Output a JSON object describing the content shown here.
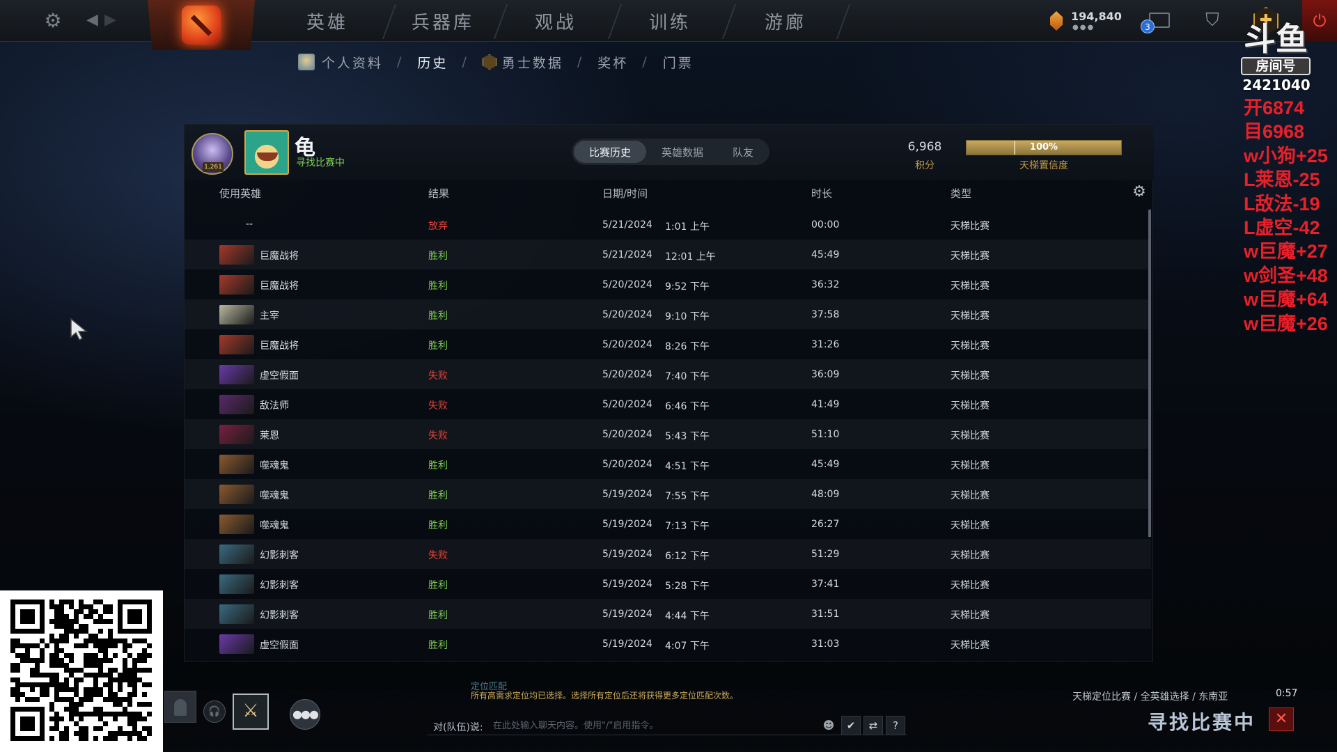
{
  "app": {
    "name": "Dota 2"
  },
  "topbar": {
    "gear_icon": "gear-icon",
    "back_icon": "arrow-left-icon",
    "forward_icon": "arrow-right-icon",
    "tabs": [
      {
        "label": "英雄"
      },
      {
        "label": "兵器库"
      },
      {
        "label": "观战"
      },
      {
        "label": "训练"
      },
      {
        "label": "游廊"
      }
    ],
    "gold": "194,840",
    "mail_badge": "3"
  },
  "subnav": {
    "items": [
      {
        "label": "个人资料"
      },
      {
        "label": "历史"
      },
      {
        "label": "勇士数据"
      },
      {
        "label": "奖杯"
      },
      {
        "label": "门票"
      }
    ],
    "active": "历史"
  },
  "overlay": {
    "logo_text": "斗鱼",
    "room_label": "房间号",
    "room_number": "2421040",
    "lines": [
      "开6874",
      "目6968",
      "w小狗+25",
      "L莱恩-25",
      "L敌法-19",
      "L虚空-42",
      "w巨魔+27",
      "w剑圣+48",
      "w巨魔+64",
      "w巨魔+26"
    ]
  },
  "profile": {
    "name": "龟",
    "status": "寻找比赛中",
    "rank_badge": "1,261",
    "tabs": [
      {
        "label": "比赛历史"
      },
      {
        "label": "英雄数据"
      },
      {
        "label": "队友"
      }
    ],
    "active_tab": "比赛历史",
    "mmr": "6,968",
    "mmr_label": "积分",
    "confidence": "100%",
    "confidence_value": 1.0,
    "confidence_label": "天梯置信度"
  },
  "table": {
    "headers": {
      "hero": "使用英雄",
      "result": "结果",
      "datetime": "日期/时间",
      "duration": "时长",
      "type": "类型"
    },
    "rows": [
      {
        "hero": "--",
        "result": "放弃",
        "date": "5/21/2024",
        "time": "1:01 上午",
        "duration": "00:00",
        "type": "天梯比赛",
        "color": "",
        "outcome": "abandon"
      },
      {
        "hero": "巨魔战将",
        "result": "胜利",
        "date": "5/21/2024",
        "time": "12:01 上午",
        "duration": "45:49",
        "type": "天梯比赛",
        "color": "#a43a2a",
        "outcome": "win"
      },
      {
        "hero": "巨魔战将",
        "result": "胜利",
        "date": "5/20/2024",
        "time": "9:52 下午",
        "duration": "36:32",
        "type": "天梯比赛",
        "color": "#a43a2a",
        "outcome": "win"
      },
      {
        "hero": "主宰",
        "result": "胜利",
        "date": "5/20/2024",
        "time": "9:10 下午",
        "duration": "37:58",
        "type": "天梯比赛",
        "color": "#b8b8a0",
        "outcome": "win"
      },
      {
        "hero": "巨魔战将",
        "result": "胜利",
        "date": "5/20/2024",
        "time": "8:26 下午",
        "duration": "31:26",
        "type": "天梯比赛",
        "color": "#a43a2a",
        "outcome": "win"
      },
      {
        "hero": "虚空假面",
        "result": "失败",
        "date": "5/20/2024",
        "time": "7:40 下午",
        "duration": "36:09",
        "type": "天梯比赛",
        "color": "#6a3aa8",
        "outcome": "loss"
      },
      {
        "hero": "敌法师",
        "result": "失败",
        "date": "5/20/2024",
        "time": "6:46 下午",
        "duration": "41:49",
        "type": "天梯比赛",
        "color": "#5a2a6a",
        "outcome": "loss"
      },
      {
        "hero": "莱恩",
        "result": "失败",
        "date": "5/20/2024",
        "time": "5:43 下午",
        "duration": "51:10",
        "type": "天梯比赛",
        "color": "#7a2040",
        "outcome": "loss"
      },
      {
        "hero": "噬魂鬼",
        "result": "胜利",
        "date": "5/20/2024",
        "time": "4:51 下午",
        "duration": "45:49",
        "type": "天梯比赛",
        "color": "#8a5a30",
        "outcome": "win"
      },
      {
        "hero": "噬魂鬼",
        "result": "胜利",
        "date": "5/19/2024",
        "time": "7:55 下午",
        "duration": "48:09",
        "type": "天梯比赛",
        "color": "#8a5a30",
        "outcome": "win"
      },
      {
        "hero": "噬魂鬼",
        "result": "胜利",
        "date": "5/19/2024",
        "time": "7:13 下午",
        "duration": "26:27",
        "type": "天梯比赛",
        "color": "#8a5a30",
        "outcome": "win"
      },
      {
        "hero": "幻影刺客",
        "result": "失败",
        "date": "5/19/2024",
        "time": "6:12 下午",
        "duration": "51:29",
        "type": "天梯比赛",
        "color": "#3a6a80",
        "outcome": "loss"
      },
      {
        "hero": "幻影刺客",
        "result": "胜利",
        "date": "5/19/2024",
        "time": "5:28 下午",
        "duration": "37:41",
        "type": "天梯比赛",
        "color": "#3a6a80",
        "outcome": "win"
      },
      {
        "hero": "幻影刺客",
        "result": "胜利",
        "date": "5/19/2024",
        "time": "4:44 下午",
        "duration": "31:51",
        "type": "天梯比赛",
        "color": "#3a6a80",
        "outcome": "win"
      },
      {
        "hero": "虚空假面",
        "result": "胜利",
        "date": "5/19/2024",
        "time": "4:07 下午",
        "duration": "31:03",
        "type": "天梯比赛",
        "color": "#6a3aa8",
        "outcome": "win"
      }
    ]
  },
  "colors": {
    "win": "#7ccf4e",
    "loss": "#e0443a",
    "abandon": "#e0443a",
    "accent_gold": "#c49a45"
  },
  "bottom": {
    "hint_title": "定位匹配",
    "hint_text": "所有高需求定位均已选择。选择所有定位后还将获得更多定位匹配次数。",
    "chat_label": "对(队伍)说:",
    "chat_placeholder": "在此处输入聊天内容。使用\"/\"启用指令。",
    "help_label": "?",
    "mode_line": "天梯定位比赛 / 全英雄选择 / 东南亚",
    "timer": "0:57",
    "find_match": "寻找比赛中"
  }
}
